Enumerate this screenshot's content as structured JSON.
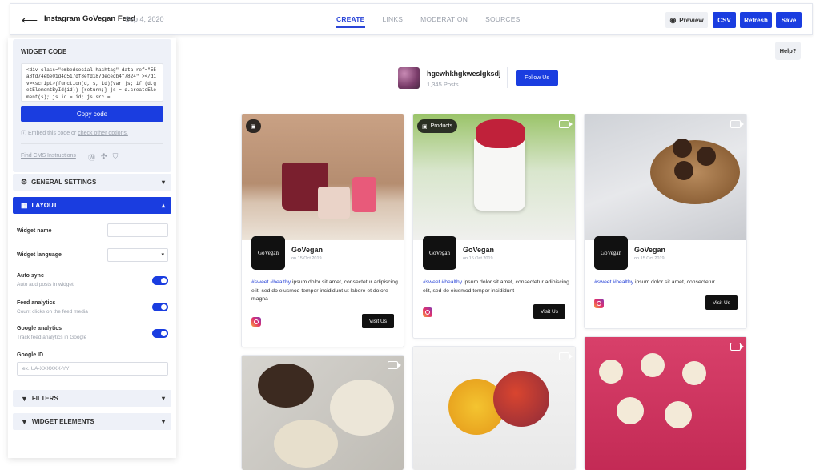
{
  "header": {
    "back_icon": "arrow-left-icon",
    "title": "Instagram GoVegan Feed",
    "date": "Sep 4, 2020",
    "tabs": [
      {
        "label": "CREATE",
        "active": true
      },
      {
        "label": "LINKS",
        "active": false
      },
      {
        "label": "MODERATION",
        "active": false
      },
      {
        "label": "SOURCES",
        "active": false
      }
    ],
    "preview_label": "Preview",
    "csv_label": "CSV",
    "refresh_label": "Refresh",
    "save_label": "Save"
  },
  "sidebar": {
    "widget_code_title": "WIDGET CODE",
    "code": "<div class=\"embedsocial-hashtag\" data-ref=\"55a8fd74ebe01d4d517df8efd187decedb4f7824\" ></div><script>(function(d, s, id){var js; if (d.getElementById(id)) {return;} js = d.createElement(s); js.id = id; js.src =",
    "copy_label": "Copy code",
    "embed_prefix": "Embed this code or ",
    "embed_link": "check other options.",
    "cms_label": "Find CMS Instructions",
    "general_settings": "GENERAL SETTINGS",
    "layout": "LAYOUT",
    "widget_name": "Widget name",
    "widget_language": "Widget language",
    "auto_sync": "Auto sync",
    "auto_sync_sub": "Auto add posts in widget",
    "feed_analytics": "Feed analytics",
    "feed_analytics_sub": "Count clicks on the feed media",
    "google_analytics": "Google analytics",
    "google_analytics_sub": "Track feed analytics in Google",
    "google_id": "Google ID",
    "google_id_placeholder": "ex. UA-XXXXXX-YY",
    "filters": "FILTERS",
    "widget_elements": "WIDGET ELEMENTS"
  },
  "help_label": "Help?",
  "profile": {
    "name": "hgewhkhgkweslgksdj",
    "posts": "1,345 Posts",
    "follow_label": "Follow Us"
  },
  "posts": [
    {
      "user": "GoVegan",
      "avatar_text": "GoVegan",
      "date": "on 15 Oct 2019",
      "tags": "#sweet #healthy",
      "text": " ipsum dolor sit amet, consectetur adipiscing elit, sed do eiusmod tempor incididunt ut labore et dolore magna",
      "visit": "Visit Us",
      "badge": ""
    },
    {
      "user": "GoVegan",
      "avatar_text": "GoVegan",
      "date": "on 15 Oct 2019",
      "tags": "#sweet #healthy",
      "text": " ipsum dolor sit amet, consectetur adipiscing elit, sed do eiusmod tempor incididunt",
      "visit": "Visit Us",
      "badge": "Products"
    },
    {
      "user": "GoVegan",
      "avatar_text": "GoVegan",
      "date": "on 15 Oct 2019",
      "tags": "#sweet #healthy",
      "text": " ipsum dolor sit amet, consectetur",
      "visit": "Visit Us",
      "badge": ""
    }
  ]
}
